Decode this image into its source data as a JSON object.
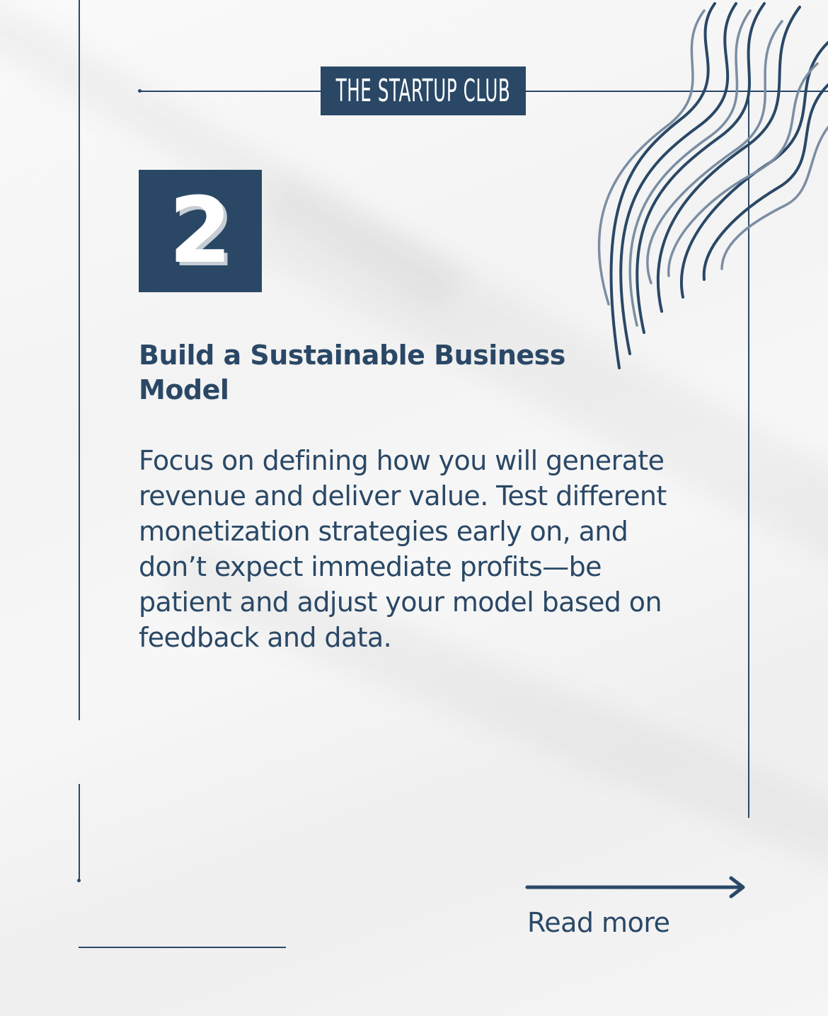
{
  "brand": {
    "name": "THE STARTUP CLUB"
  },
  "step": {
    "number": "2"
  },
  "content": {
    "heading_line1": "Build a Sustainable Business",
    "heading_line2": "Model",
    "body": "Focus on defining how you will generate revenue and deliver value. Test different monetization strategies early on, and don’t expect immediate profits—be patient and adjust your model based on feedback and data."
  },
  "cta": {
    "label": "Read more"
  },
  "colors": {
    "accent": "#2a4866",
    "background": "#f5f5f5"
  },
  "icons": {
    "decoration": "wavy-lines-icon",
    "arrow": "arrow-right-icon"
  }
}
